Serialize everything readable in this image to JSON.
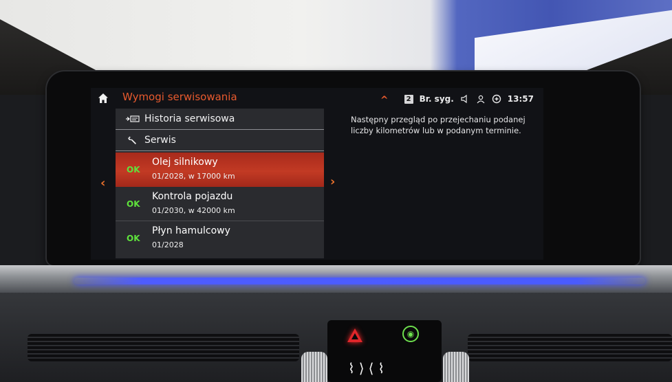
{
  "header": {
    "title": "Wymogi serwisowania",
    "message_count": "2",
    "radio_label": "Br. syg.",
    "time": "13:57"
  },
  "menu": {
    "history_label": "Historia serwisowa",
    "service_label": "Serwis",
    "items": [
      {
        "status": "OK",
        "name": "Olej silnikowy",
        "due": "01/2028, w 17000 km",
        "selected": true
      },
      {
        "status": "OK",
        "name": "Kontrola pojazdu",
        "due": "01/2030, w 42000 km",
        "selected": false
      },
      {
        "status": "OK",
        "name": "Płyn hamulcowy",
        "due": "01/2028",
        "selected": false
      }
    ]
  },
  "info_panel": {
    "text": "Następny przegląd po przejechaniu podanej liczby kilometrów lub w podanym terminie."
  },
  "icons": {
    "home": "home-icon",
    "chevron_up": "chevron-up-icon",
    "mute": "speaker-icon",
    "profile": "driver-profile-icon",
    "connectivity": "connectivity-icon",
    "history": "service-history-icon",
    "service": "wrench-icon",
    "nav_left": "chevron-left-icon",
    "nav_right": "chevron-right-icon"
  },
  "colors": {
    "accent": "#e85a2e",
    "ok": "#5fe33c",
    "selected_row": "#c23a24",
    "menu_background": "#2a2b2f",
    "screen_background": "#111216"
  }
}
